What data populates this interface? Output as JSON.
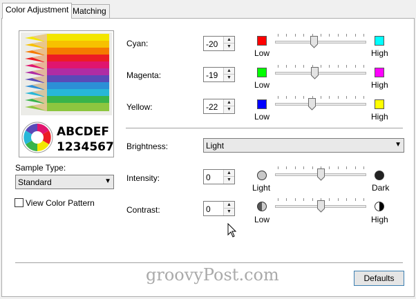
{
  "tabs": [
    {
      "label": "Color Adjustment"
    },
    {
      "label": "Matching"
    }
  ],
  "preview": {
    "line1": "ABCDEF",
    "line2": "1234567"
  },
  "sample_type": {
    "label": "Sample Type:",
    "value": "Standard"
  },
  "view_color_pattern": {
    "label": "View Color Pattern",
    "checked": false
  },
  "cyan": {
    "label": "Cyan:",
    "value": "-20",
    "low_label": "Low",
    "high_label": "High",
    "low_color": "#ff0000",
    "high_color": "#00ffff",
    "level": 0.42
  },
  "magenta": {
    "label": "Magenta:",
    "value": "-19",
    "low_label": "Low",
    "high_label": "High",
    "low_color": "#00ff00",
    "high_color": "#ff00ff",
    "level": 0.43
  },
  "yellow": {
    "label": "Yellow:",
    "value": "-22",
    "low_label": "Low",
    "high_label": "High",
    "low_color": "#0000ff",
    "high_color": "#ffff00",
    "level": 0.4
  },
  "brightness": {
    "label": "Brightness:",
    "value": "Light"
  },
  "intensity": {
    "label": "Intensity:",
    "value": "0",
    "low_label": "Light",
    "high_label": "Dark",
    "level": 0.5
  },
  "contrast": {
    "label": "Contrast:",
    "value": "0",
    "low_label": "Low",
    "high_label": "High",
    "level": 0.5
  },
  "defaults_button": "Defaults",
  "watermark": "groovyPost.com"
}
